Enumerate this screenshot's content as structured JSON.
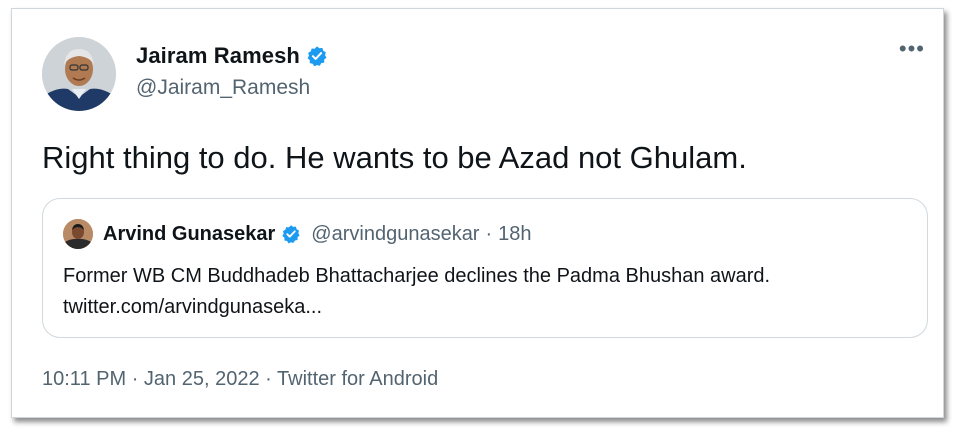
{
  "tweet": {
    "author_name": "Jairam Ramesh",
    "author_handle": "@Jairam_Ramesh",
    "verified_icon": "verified-badge-icon",
    "more_icon": "•••",
    "text": "Right thing to do. He wants to be Azad not Ghulam.",
    "timestamp": "10:11 PM",
    "date": "Jan 25, 2022",
    "source": "Twitter for Android",
    "separator": "·"
  },
  "quoted_tweet": {
    "author_name": "Arvind Gunasekar",
    "author_handle": "@arvindgunasekar",
    "separator": "·",
    "time_ago": "18h",
    "text_line1": "Former WB CM Buddhadeb Bhattacharjee declines the Padma Bhushan award.",
    "text_line2": "twitter.com/arvindgunaseka..."
  },
  "colors": {
    "primary_text": "#0f1419",
    "secondary_text": "#536471",
    "verified_blue": "#1d9bf0",
    "border": "#cfd9de"
  }
}
